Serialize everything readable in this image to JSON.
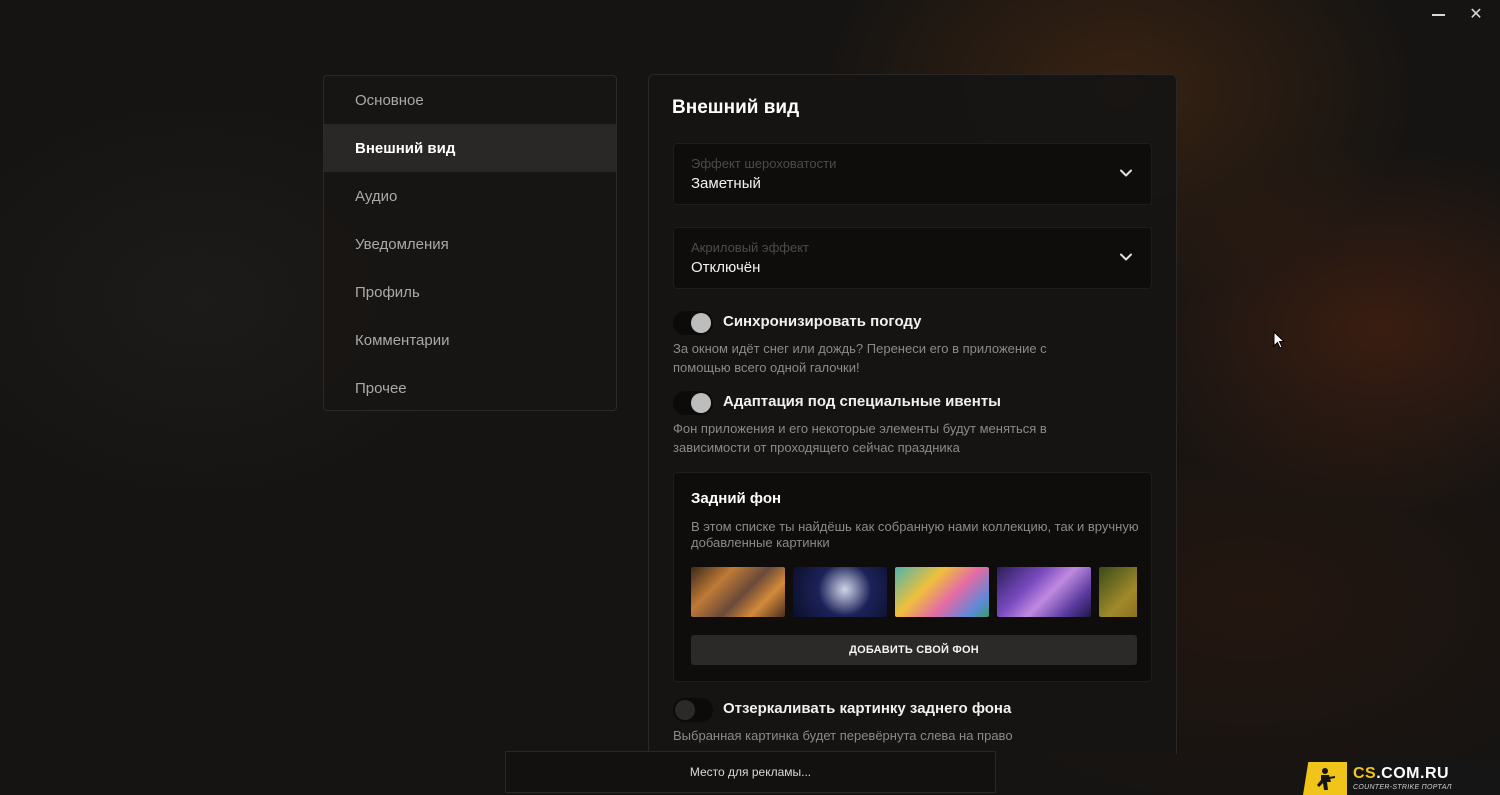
{
  "window": {
    "minimize_icon": "minimize-icon",
    "close_icon": "close-icon",
    "close_glyph": "✕"
  },
  "sidebar": {
    "items": [
      {
        "label": "Основное",
        "active": false
      },
      {
        "label": "Внешний вид",
        "active": true
      },
      {
        "label": "Аудио",
        "active": false
      },
      {
        "label": "Уведомления",
        "active": false
      },
      {
        "label": "Профиль",
        "active": false
      },
      {
        "label": "Комментарии",
        "active": false
      },
      {
        "label": "Прочее",
        "active": false
      }
    ]
  },
  "main": {
    "title": "Внешний вид",
    "roughness": {
      "label": "Эффект шероховатости",
      "value": "Заметный"
    },
    "acrylic": {
      "label": "Акриловый эффект",
      "value": "Отключён"
    },
    "weather": {
      "label": "Синхронизировать погоду",
      "description": "За окном идёт снег или дождь? Перенеси его в приложение с помощью всего одной галочки!",
      "enabled": true
    },
    "events": {
      "label": "Адаптация под специальные ивенты",
      "description": "Фон приложения и его некоторые элементы будут меняться в зависимости от проходящего сейчас праздника",
      "enabled": true
    },
    "background": {
      "title": "Задний фон",
      "description": "В этом списке ты найдёшь как собранную нами коллекцию, так и вручную добавленные картинки",
      "thumbnail_count": 5,
      "add_button": "ДОБАВИТЬ СВОЙ ФОН"
    },
    "mirror": {
      "label": "Отзеркаливать картинку заднего фона",
      "description": "Выбранная картинка будет перевёрнута слева на право",
      "enabled": false
    }
  },
  "ad": {
    "text": "Место для рекламы..."
  },
  "watermark": {
    "main_prefix": "CS",
    "main_suffix": ".COM.RU",
    "sub": "COUNTER-STRIKE ПОРТАЛ"
  }
}
